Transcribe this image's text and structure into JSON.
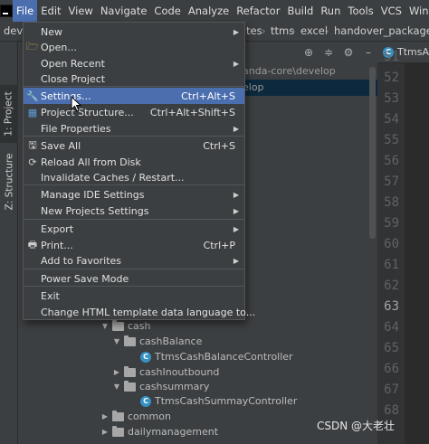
{
  "menubar": {
    "items": [
      "File",
      "Edit",
      "View",
      "Navigate",
      "Code",
      "Analyze",
      "Refactor",
      "Build",
      "Run",
      "Tools",
      "VCS",
      "Window"
    ]
  },
  "navbar": {
    "left": "devel",
    "crumbs": [
      "tes",
      "ttms",
      "excel",
      "handover_package"
    ]
  },
  "toolstrip": {
    "project_tab": "1: Project",
    "structure_tab": "Z: Structure"
  },
  "project_panel": {
    "bg_line1": "anda-core\\develop",
    "bg_line2": "elop",
    "tree": [
      {
        "label": "cash",
        "type": "folder",
        "expanded": true
      },
      {
        "label": "cashBalance",
        "type": "folder",
        "expanded": true
      },
      {
        "label": "TtmsCashBalanceController",
        "type": "class"
      },
      {
        "label": "cashInoutbound",
        "type": "folder",
        "expanded": false
      },
      {
        "label": "cashsummary",
        "type": "folder",
        "expanded": true
      },
      {
        "label": "TtmsCashSummayController",
        "type": "class"
      },
      {
        "label": "common",
        "type": "folder",
        "expanded": false
      },
      {
        "label": "dailymanagement",
        "type": "folder",
        "expanded": false
      }
    ]
  },
  "editor": {
    "tab_label": "TtmsAc",
    "line_numbers": [
      "51",
      "52",
      "53",
      "54",
      "55",
      "56",
      "57",
      "58",
      "59",
      "60",
      "61",
      "62",
      "63",
      "64",
      "65",
      "66",
      "67",
      "68"
    ],
    "current_line": "63",
    "class_glyph": "C"
  },
  "file_menu": {
    "items": [
      {
        "label": "New",
        "shortcut": "",
        "submenu": true,
        "icon": ""
      },
      {
        "label": "Open...",
        "shortcut": "",
        "submenu": false,
        "icon": "folder-open-icon"
      },
      {
        "label": "Open Recent",
        "shortcut": "",
        "submenu": true,
        "icon": ""
      },
      {
        "label": "Close Project",
        "shortcut": "",
        "submenu": false,
        "icon": ""
      },
      {
        "label": "Settings...",
        "shortcut": "Ctrl+Alt+S",
        "submenu": false,
        "icon": "wrench-icon",
        "selected": true
      },
      {
        "label": "Project Structure...",
        "shortcut": "Ctrl+Alt+Shift+S",
        "submenu": false,
        "icon": "project-structure-icon"
      },
      {
        "label": "File Properties",
        "shortcut": "",
        "submenu": true,
        "icon": ""
      },
      {
        "label": "Save All",
        "shortcut": "Ctrl+S",
        "submenu": false,
        "icon": "save-icon"
      },
      {
        "label": "Reload All from Disk",
        "shortcut": "",
        "submenu": false,
        "icon": "reload-icon"
      },
      {
        "label": "Invalidate Caches / Restart...",
        "shortcut": "",
        "submenu": false,
        "icon": ""
      },
      {
        "label": "Manage IDE Settings",
        "shortcut": "",
        "submenu": true,
        "icon": ""
      },
      {
        "label": "New Projects Settings",
        "shortcut": "",
        "submenu": true,
        "icon": ""
      },
      {
        "label": "Export",
        "shortcut": "",
        "submenu": true,
        "icon": ""
      },
      {
        "label": "Print...",
        "shortcut": "Ctrl+P",
        "submenu": false,
        "icon": "print-icon"
      },
      {
        "label": "Add to Favorites",
        "shortcut": "",
        "submenu": true,
        "icon": ""
      },
      {
        "label": "Power Save Mode",
        "shortcut": "",
        "submenu": false,
        "icon": ""
      },
      {
        "label": "Exit",
        "shortcut": "",
        "submenu": false,
        "icon": ""
      },
      {
        "label": "Change HTML template data language to...",
        "shortcut": "",
        "submenu": false,
        "icon": ""
      }
    ]
  },
  "watermark": "CSDN @大老壮",
  "colors": {
    "menu_bg": "#3c3f41",
    "selection": "#4b6eaf",
    "editor_bg": "#2b2b2b",
    "class_icon": "#3592c4"
  }
}
